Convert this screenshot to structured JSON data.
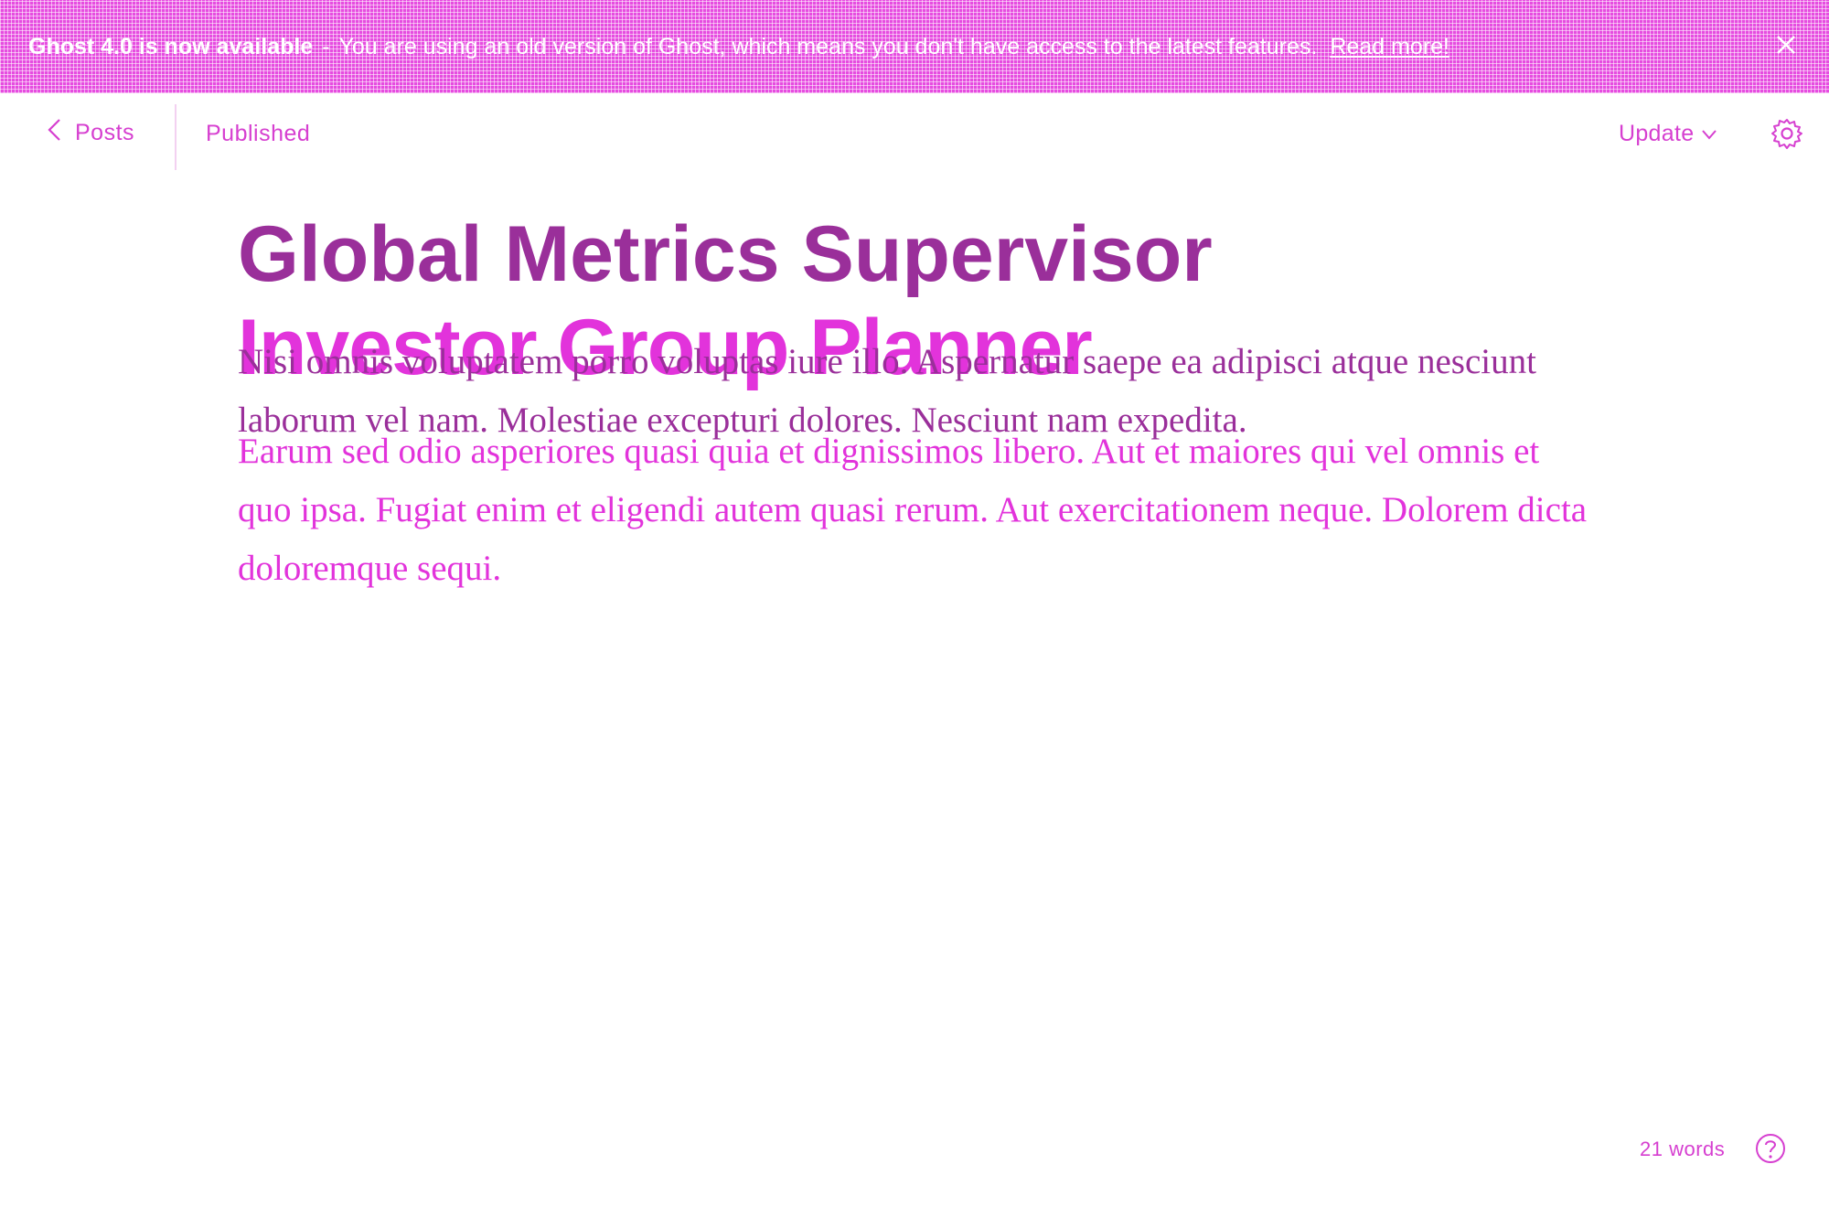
{
  "banner": {
    "title": "Ghost 4.0 is now available",
    "separator": "-",
    "message": "You are using an old version of Ghost, which means you don't have access to the latest features.",
    "link_label": "Read more!",
    "close_icon": "close-icon"
  },
  "header": {
    "back_label": "Posts",
    "back_icon": "chevron-left-icon",
    "status": "Published",
    "update_label": "Update",
    "update_icon": "chevron-down-icon",
    "settings_icon": "gear-icon"
  },
  "post": {
    "title": "Global Metrics Supervisor",
    "title_overlay": "Investor Group Planner",
    "paragraph_1": "Nisi omnis voluptatem porro voluptas iure illo. Aspernatur saepe ea adipisci atque nesciunt laborum vel nam. Molestiae excepturi dolores. Nesciunt nam expedita.",
    "paragraph_2": "Earum sed odio asperiores quasi quia et dignissimos libero. Aut et maiores qui vel omnis et quo ipsa. Fugiat enim et eligendi autem quasi rerum. Aut exercitationem neque. Dolorem dicta doloremque sequi."
  },
  "footer": {
    "word_count": "21 words",
    "help_icon": "help-icon"
  },
  "colors": {
    "accent": "#e233db",
    "dark_accent": "#9a2f9a"
  }
}
